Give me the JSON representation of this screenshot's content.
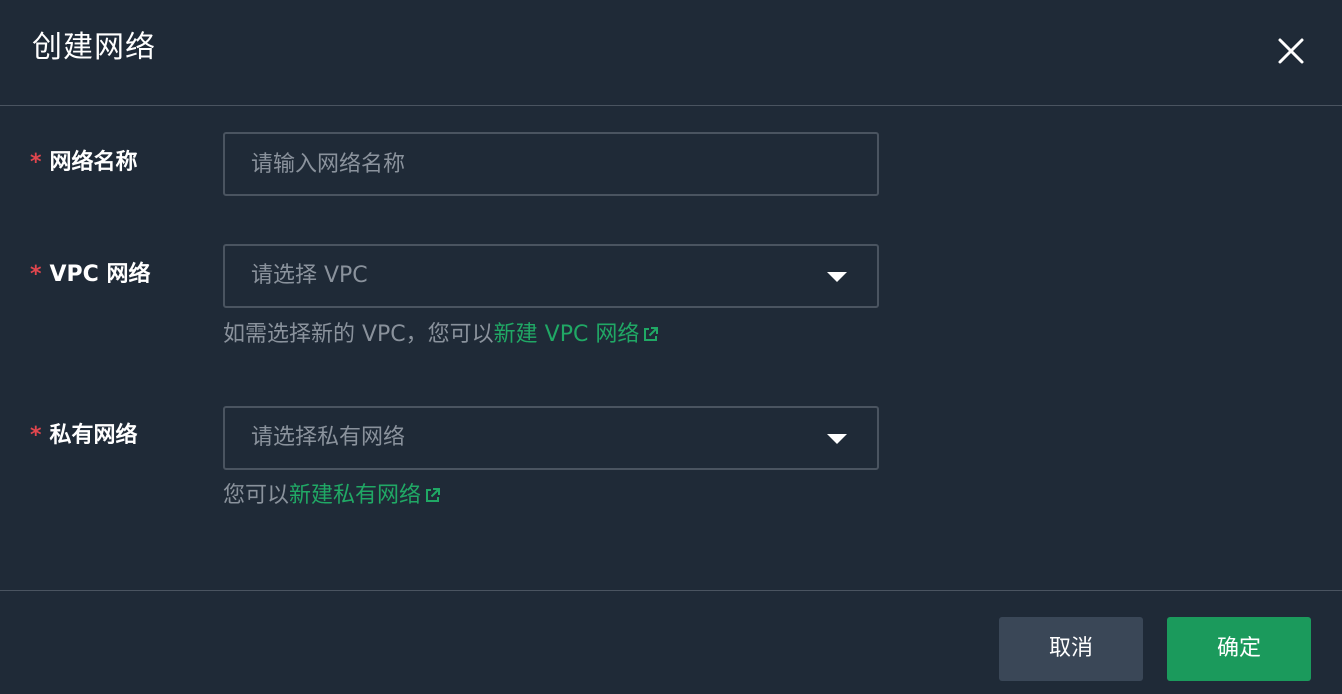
{
  "dialog": {
    "title": "创建网络",
    "close_icon": "close-icon"
  },
  "form": {
    "required_mark": "*",
    "network_name": {
      "label": "网络名称",
      "placeholder": "请输入网络名称",
      "value": ""
    },
    "vpc": {
      "label": "VPC 网络",
      "placeholder": "请选择 VPC",
      "help_prefix": "如需选择新的 VPC，您可以",
      "help_link": "新建 VPC 网络",
      "link_icon": "external-link-icon"
    },
    "private_network": {
      "label": "私有网络",
      "placeholder": "请选择私有网络",
      "help_prefix": "您可以",
      "help_link": "新建私有网络",
      "link_icon": "external-link-icon"
    }
  },
  "footer": {
    "cancel_label": "取消",
    "confirm_label": "确定"
  },
  "colors": {
    "background": "#1f2a37",
    "border": "#4a5460",
    "required": "#e0464e",
    "link": "#20a865",
    "primary_button": "#1b9a5c",
    "secondary_button": "#3a4757",
    "placeholder": "#8a929c"
  }
}
